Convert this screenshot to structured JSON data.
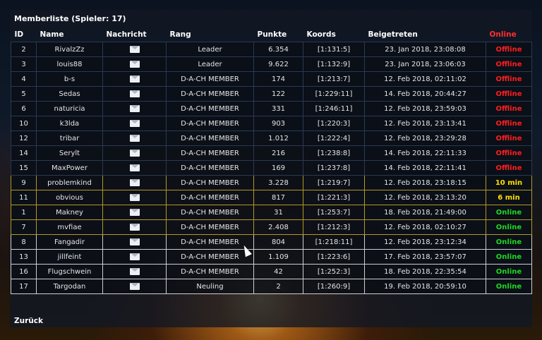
{
  "title": "Memberliste (Spieler: 17)",
  "columns": [
    "ID",
    "Name",
    "Nachricht",
    "Rang",
    "Punkte",
    "Koords",
    "Beigetreten",
    "Online"
  ],
  "back_label": "Zurück",
  "colors": {
    "offline": "#ff1e1e",
    "minutes": "#ffe000",
    "online": "#20d820"
  },
  "mail_icon": "envelope-icon",
  "members": [
    {
      "id": "2",
      "name": "RivalzZz",
      "rank": "Leader",
      "points": "6.354",
      "coords": "[1:131:5]",
      "joined": "23. Jan 2018, 23:08:08",
      "online": "Offline",
      "status": "offline"
    },
    {
      "id": "3",
      "name": "louis88",
      "rank": "Leader",
      "points": "9.622",
      "coords": "[1:132:9]",
      "joined": "23. Jan 2018, 23:06:03",
      "online": "Offline",
      "status": "offline"
    },
    {
      "id": "4",
      "name": "b-s",
      "rank": "D-A-CH MEMBER",
      "points": "174",
      "coords": "[1:213:7]",
      "joined": "12. Feb 2018, 02:11:02",
      "online": "Offline",
      "status": "offline"
    },
    {
      "id": "5",
      "name": "Sedas",
      "rank": "D-A-CH MEMBER",
      "points": "122",
      "coords": "[1:229:11]",
      "joined": "14. Feb 2018, 20:44:27",
      "online": "Offline",
      "status": "offline"
    },
    {
      "id": "6",
      "name": "naturicia",
      "rank": "D-A-CH MEMBER",
      "points": "331",
      "coords": "[1:246:11]",
      "joined": "12. Feb 2018, 23:59:03",
      "online": "Offline",
      "status": "offline"
    },
    {
      "id": "10",
      "name": "k3lda",
      "rank": "D-A-CH MEMBER",
      "points": "903",
      "coords": "[1:220:3]",
      "joined": "12. Feb 2018, 23:13:41",
      "online": "Offline",
      "status": "offline"
    },
    {
      "id": "12",
      "name": "tribar",
      "rank": "D-A-CH MEMBER",
      "points": "1.012",
      "coords": "[1:222:4]",
      "joined": "12. Feb 2018, 23:29:28",
      "online": "Offline",
      "status": "offline"
    },
    {
      "id": "14",
      "name": "Serylt",
      "rank": "D-A-CH MEMBER",
      "points": "216",
      "coords": "[1:238:8]",
      "joined": "14. Feb 2018, 22:11:33",
      "online": "Offline",
      "status": "offline"
    },
    {
      "id": "15",
      "name": "MaxPower",
      "rank": "D-A-CH MEMBER",
      "points": "169",
      "coords": "[1:237:8]",
      "joined": "14. Feb 2018, 22:11:41",
      "online": "Offline",
      "status": "offline"
    },
    {
      "id": "9",
      "name": "problemkind",
      "rank": "D-A-CH MEMBER",
      "points": "3.228",
      "coords": "[1:219:7]",
      "joined": "12. Feb 2018, 23:18:15",
      "online": "10 min",
      "status": "mins"
    },
    {
      "id": "11",
      "name": "obvious",
      "rank": "D-A-CH MEMBER",
      "points": "817",
      "coords": "[1:221:3]",
      "joined": "12. Feb 2018, 23:13:20",
      "online": "6 min",
      "status": "mins"
    },
    {
      "id": "1",
      "name": "Makney",
      "rank": "D-A-CH MEMBER",
      "points": "31",
      "coords": "[1:253:7]",
      "joined": "18. Feb 2018, 21:49:00",
      "online": "Online",
      "status": "online"
    },
    {
      "id": "7",
      "name": "mvfiae",
      "rank": "D-A-CH MEMBER",
      "points": "2.408",
      "coords": "[1:212:3]",
      "joined": "12. Feb 2018, 02:10:27",
      "online": "Online",
      "status": "online"
    },
    {
      "id": "8",
      "name": "Fangadir",
      "rank": "D-A-CH MEMBER",
      "points": "804",
      "coords": "[1:218:11]",
      "joined": "12. Feb 2018, 23:12:34",
      "online": "Online",
      "status": "online"
    },
    {
      "id": "13",
      "name": "jillfeint",
      "rank": "D-A-CH MEMBER",
      "points": "1.109",
      "coords": "[1:223:6]",
      "joined": "17. Feb 2018, 23:57:07",
      "online": "Online",
      "status": "online"
    },
    {
      "id": "16",
      "name": "Flugschwein",
      "rank": "D-A-CH MEMBER",
      "points": "42",
      "coords": "[1:252:3]",
      "joined": "18. Feb 2018, 22:35:54",
      "online": "Online",
      "status": "online"
    },
    {
      "id": "17",
      "name": "Targodan",
      "rank": "Neuling",
      "points": "2",
      "coords": "[1:260:9]",
      "joined": "19. Feb 2018, 20:59:10",
      "online": "Online",
      "status": "online"
    }
  ]
}
